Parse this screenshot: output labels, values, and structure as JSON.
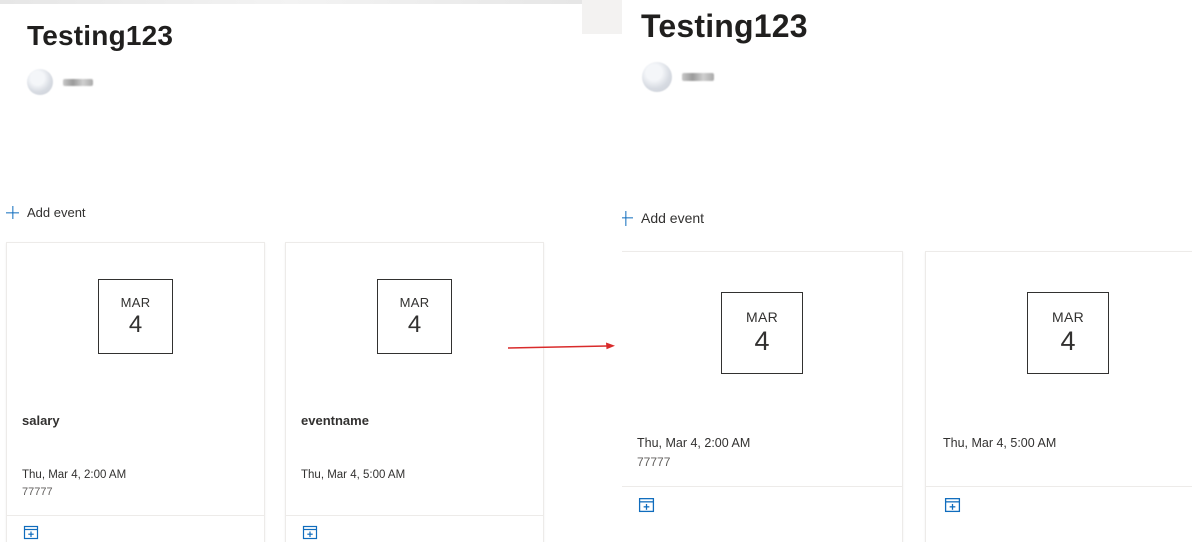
{
  "left": {
    "title": "Testing123",
    "add_event_label": "Add event",
    "cards": [
      {
        "month": "MAR",
        "day": "4",
        "title": "salary",
        "time": "Thu, Mar 4, 2:00 AM",
        "location": "77777"
      },
      {
        "month": "MAR",
        "day": "4",
        "title": "eventname",
        "time": "Thu, Mar 4, 5:00 AM",
        "location": ""
      }
    ]
  },
  "right": {
    "title": "Testing123",
    "add_event_label": "Add event",
    "cards": [
      {
        "month": "MAR",
        "day": "4",
        "time": "Thu, Mar 4, 2:00 AM",
        "location": "77777"
      },
      {
        "month": "MAR",
        "day": "4",
        "time": "Thu, Mar 4, 5:00 AM",
        "location": ""
      }
    ]
  },
  "icons": {
    "add": "plus-icon",
    "calendar": "add-to-calendar-icon",
    "arrow": "red-arrow"
  },
  "colors": {
    "accent": "#0f6cbd",
    "arrow": "#d92b2b",
    "text": "#323130"
  }
}
